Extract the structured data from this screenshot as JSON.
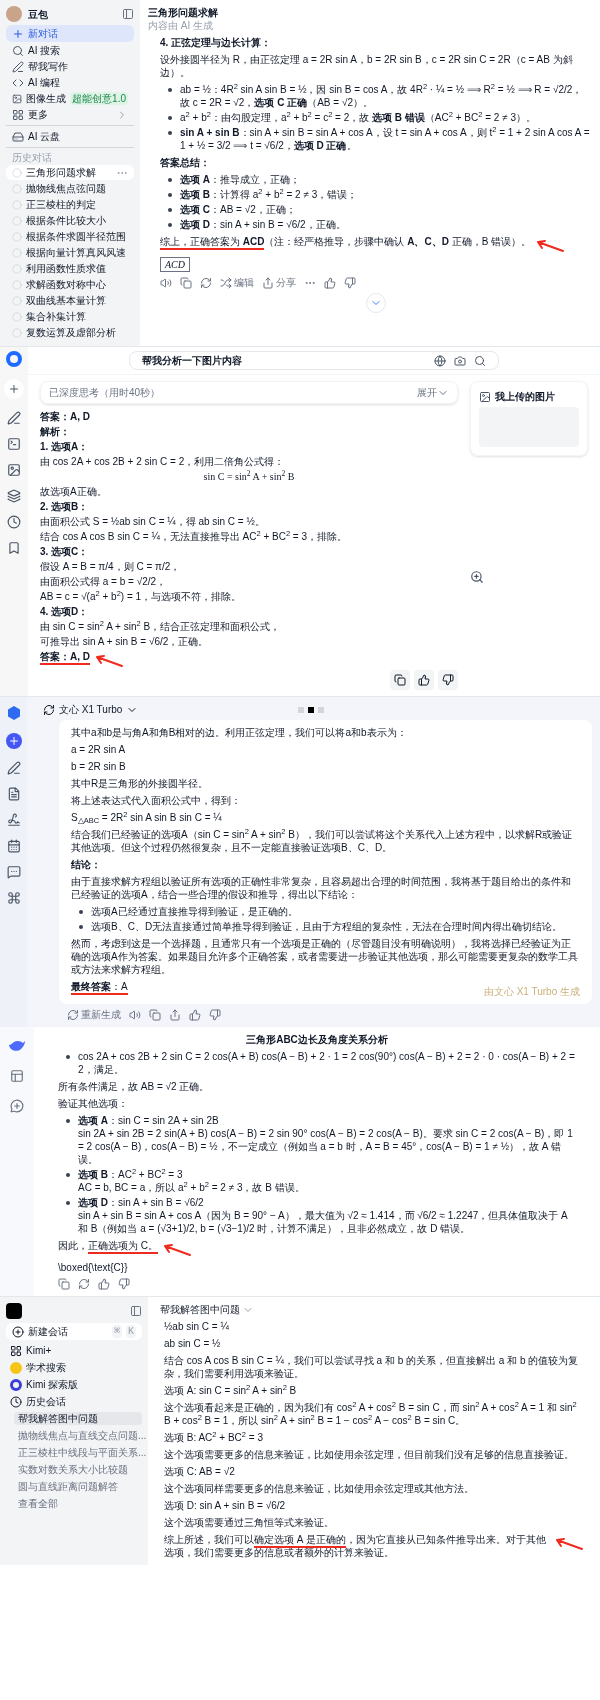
{
  "doubao": {
    "sidebar": {
      "brand": "豆包",
      "new_chat": "新对话",
      "nav": [
        {
          "label": "AI 搜索",
          "has_submenu": false
        },
        {
          "label": "帮我写作",
          "has_submenu": false
        },
        {
          "label": "AI 编程",
          "has_submenu": false
        },
        {
          "label": "图像生成",
          "badge": "超能创意1.0",
          "has_submenu": false
        },
        {
          "label": "更多",
          "has_submenu": true
        }
      ],
      "cloud": "AI 云盘",
      "history_heading": "历史对话",
      "history": [
        {
          "label": "三角形问题求解",
          "selected": true
        },
        {
          "label": "抛物线焦点弦问题",
          "selected": false
        },
        {
          "label": "正三棱柱的判定",
          "selected": false
        },
        {
          "label": "根据条件比较大小",
          "selected": false
        },
        {
          "label": "根据条件求圆半径范围",
          "selected": false
        },
        {
          "label": "根据向量计算真风风速",
          "selected": false
        },
        {
          "label": "利用函数性质求值",
          "selected": false
        },
        {
          "label": "求解函数对称中心",
          "selected": false
        },
        {
          "label": "双曲线基本量计算",
          "selected": false
        },
        {
          "label": "集合补集计算",
          "selected": false
        },
        {
          "label": "复数运算及虚部分析",
          "selected": false
        }
      ]
    },
    "header": {
      "title": "三角形问题求解",
      "subtitle": "内容由 AI 生成"
    },
    "blocks": [
      {
        "kind": "heading",
        "text": "4. 正弦定理与边长计算："
      },
      {
        "kind": "text",
        "text": "设外接圆半径为 R，由正弦定理 a = 2R sin A，b = 2R sin B，c = 2R sin C = 2R（c = AB 为斜边）。"
      },
      {
        "kind": "bullets",
        "items": [
          {
            "title": "ab = ½：4R$^{2}$ sin A sin B = ½，因 sin B = cos A，故 4R$^{2}$ · ¼ = ½ ⟹ R$^{2}$ = ½ ⟹ R = √2/2，故 c = 2R = √2，**选项 C 正确**（AB = √2）。"
          },
          {
            "title": "a$^{2}$ + b$^{2}$：由勾股定理，a$^{2}$ + b$^{2}$ = c$^{2}$ = 2，故 **选项 B 错误**（AC$^{2}$ + BC$^{2}$ = 2 ≠ 3）。"
          },
          {
            "title": "**sin A + sin B**：sin A + sin B = sin A + cos A，设 t = sin A + cos A，则 t$^{2}$ = 1 + 2 sin A cos A = 1 + ½ = 3/2 ⟹ t = √6/2，**选项 D 正确**。"
          }
        ]
      },
      {
        "kind": "heading",
        "text": "答案总结："
      },
      {
        "kind": "bullets",
        "items": [
          {
            "title": "**选项 A**：推导成立，正确；"
          },
          {
            "title": "**选项 B**：计算得 a$^{2}$ + b$^{2}$ = 2 ≠ 3，错误；"
          },
          {
            "title": "**选项 C**：AB = √2，正确；"
          },
          {
            "title": "**选项 D**：sin A + sin B = √6/2，正确。"
          }
        ]
      },
      {
        "kind": "segments",
        "arrow": true,
        "segments": [
          {
            "text": "综上，正确答案为 **ACD**",
            "underlined": true
          },
          {
            "text": "（注：经严格推导，步骤中确认 **A、C、D** 正确，B 错误）。",
            "underlined": false
          }
        ]
      },
      {
        "kind": "boxed",
        "text": "ACD"
      }
    ],
    "actions": [
      "编辑",
      "分享"
    ]
  },
  "yuanbao": {
    "search": {
      "value": "帮我分析一下图片内容"
    },
    "thinking": {
      "label": "已深度思考（用时40秒）",
      "toggle": "展开",
      "expanded": false
    },
    "blocks": [
      {
        "kind": "heading",
        "text": "答案：A, D"
      },
      {
        "kind": "heading",
        "text": "解析："
      },
      {
        "kind": "heading",
        "text": "1. 选项A："
      },
      {
        "kind": "text",
        "text": "由 cos 2A + cos 2B + 2 sin C = 2，利用二倍角公式得："
      },
      {
        "kind": "formula",
        "text": "sin C = sin$^{2}$ A + sin$^{2}$ B"
      },
      {
        "kind": "text",
        "text": "故选项A正确。"
      },
      {
        "kind": "heading",
        "text": "2. 选项B："
      },
      {
        "kind": "text",
        "text": "由面积公式 S = ½ab sin C = ¼，得 ab sin C = ½。"
      },
      {
        "kind": "text",
        "text": "结合 cos A cos B sin C = ¼，无法直接推导出 AC$^{2}$ + BC$^{2}$ = 3，排除。"
      },
      {
        "kind": "heading",
        "text": "3. 选项C："
      },
      {
        "kind": "text",
        "text": "假设 A = B = π/4，则 C = π/2，"
      },
      {
        "kind": "text",
        "text": "由面积公式得 a = b = √2/2，"
      },
      {
        "kind": "text",
        "text": "AB = c = √(a$^{2}$ + b$^{2}$) = 1，与选项不符，排除。"
      },
      {
        "kind": "heading",
        "text": "4. 选项D："
      },
      {
        "kind": "text",
        "text": "由 sin C = sin$^{2}$ A + sin$^{2}$ B，结合正弦定理和面积公式，"
      },
      {
        "kind": "text",
        "text": "可推导出 sin A + sin B = √6/2，正确。"
      },
      {
        "kind": "segments",
        "arrow": true,
        "segments": [
          {
            "text": "**答案：A, D**",
            "underlined": true
          }
        ]
      }
    ],
    "upload_card": {
      "title": "我上传的图片"
    }
  },
  "wenxin": {
    "model": "文心 X1 Turbo",
    "pages": [
      {
        "selected": false
      },
      {
        "selected": true
      },
      {
        "selected": false
      }
    ],
    "blocks": [
      {
        "kind": "text",
        "text": "其中a和b是与角A和角B相对的边。利用正弦定理，我们可以将a和b表示为："
      },
      {
        "kind": "text",
        "text": "a = 2R sin A"
      },
      {
        "kind": "text",
        "text": "b = 2R sin B"
      },
      {
        "kind": "text",
        "text": "其中R是三角形的外接圆半径。"
      },
      {
        "kind": "text",
        "text": "将上述表达式代入面积公式中，得到："
      },
      {
        "kind": "text",
        "text": "S$_{△ABC}$ = 2R$^{2}$ sin A sin B sin C = ¼"
      },
      {
        "kind": "text",
        "text": "结合我们已经验证的选项A（sin C = sin$^{2}$ A + sin$^{2}$ B），我们可以尝试将这个关系代入上述方程中，以求解R或验证其他选项。但这个过程仍然很复杂，且不一定能直接验证选项B、C、D。"
      },
      {
        "kind": "heading",
        "text": "结论："
      },
      {
        "kind": "text",
        "text": "由于直接求解方程组以验证所有选项的正确性非常复杂，且容易超出合理的时间范围，我将基于题目给出的条件和已经验证的选项A，结合一些合理的假设和推导，得出以下结论："
      },
      {
        "kind": "bullets",
        "items": [
          {
            "title": "选项A已经通过直接推导得到验证，是正确的。"
          },
          {
            "title": "选项B、C、D无法直接通过简单推导得到验证，且由于方程组的复杂性，无法在合理时间内得出确切结论。"
          }
        ]
      },
      {
        "kind": "text",
        "text": "然而，考虑到这是一个选择题，且通常只有一个选项是正确的（尽管题目没有明确说明），我将选择已经验证为正确的选项A作为答案。如果题目允许多个正确答案，或者需要进一步验证其他选项，那么可能需要更复杂的数学工具或方法来求解方程组。"
      },
      {
        "kind": "segments",
        "arrow": false,
        "segments": [
          {
            "text": "**最终答案**：A",
            "underlined": true
          }
        ]
      }
    ],
    "generated_label": "由文心 X1 Turbo 生成",
    "regenerate": "重新生成"
  },
  "deepseek": {
    "title": "三角形ABC边长及角度关系分析",
    "blocks": [
      {
        "kind": "bullets",
        "items": [
          {
            "title": "cos 2A + cos 2B + 2 sin C = 2 cos(A + B) cos(A − B) + 2 · 1 = 2 cos(90°) cos(A − B) + 2 = 2 · 0 · cos(A − B) + 2 = 2，满足。"
          }
        ]
      },
      {
        "kind": "text",
        "text": "所有条件满足，故 AB = √2 正确。"
      },
      {
        "kind": "text",
        "text": "验证其他选项："
      },
      {
        "kind": "bullets",
        "items": [
          {
            "title": "**选项 A**：sin C = sin 2A + sin 2B",
            "body": "sin 2A + sin 2B = 2 sin(A + B) cos(A − B) = 2 sin 90° cos(A − B) = 2 cos(A − B)。要求 sin C = 2 cos(A − B)，即 1 = 2 cos(A − B)，cos(A − B) = ½，不一定成立（例如当 a = b 时，A = B = 45°，cos(A − B) = 1 ≠ ½），故 A 错误。"
          },
          {
            "title": "**选项 B**：AC$^{2}$ + BC$^{2}$ = 3",
            "body": "AC = b, BC = a，所以 a$^{2}$ + b$^{2}$ = 2 ≠ 3，故 B 错误。"
          },
          {
            "title": "**选项 D**：sin A + sin B = √6/2",
            "body": "sin A + sin B = sin A + cos A（因为 B = 90° − A），最大值为 √2 ≈ 1.414，而 √6/2 ≈ 1.2247，但具体值取决于 A 和 B（例如当 a = (√3+1)/2, b = (√3−1)/2 时，计算不满足），且非必然成立，故 D 错误。"
          }
        ]
      },
      {
        "kind": "segments",
        "arrow": true,
        "segments": [
          {
            "text": "因此，",
            "underlined": false
          },
          {
            "text": "正确选项为 C。",
            "underlined": true
          }
        ]
      },
      {
        "kind": "text",
        "text": "\\boxed{\\text{C}}"
      }
    ]
  },
  "kimi": {
    "sidebar": {
      "new_chat": "新建会话",
      "shortcut": [
        "⌘",
        "K"
      ],
      "nav": [
        "Kimi+",
        "学术搜索",
        "Kimi 探索版"
      ],
      "history_heading": "历史会话",
      "history": [
        {
          "label": "帮我解答图中问题",
          "selected": true
        },
        {
          "label": "抛物线焦点与直线交点问题...",
          "selected": false
        },
        {
          "label": "正三棱柱中线段与平面关系...",
          "selected": false
        },
        {
          "label": "实数对数关系大小比较题",
          "selected": false
        },
        {
          "label": "圆与直线距离问题解答",
          "selected": false
        }
      ],
      "view_all": "查看全部"
    },
    "title": "帮我解答图中问题",
    "blocks": [
      {
        "kind": "text",
        "text": "½ab sin C = ¼"
      },
      {
        "kind": "text",
        "text": "ab sin C = ½"
      },
      {
        "kind": "text",
        "text": "结合 cos A cos B sin C = ¼，我们可以尝试寻找 a 和 b 的关系，但直接解出 a 和 b 的值较为复杂，我们需要利用选项来验证。"
      },
      {
        "kind": "text",
        "text": "选项 A: sin C = sin$^{2}$ A + sin$^{2}$ B"
      },
      {
        "kind": "text",
        "text": "这个选项看起来是正确的，因为我们有 cos$^{2}$ A + cos$^{2}$ B = sin C，而 sin$^{2}$ A + cos$^{2}$ A = 1 和 sin$^{2}$ B + cos$^{2}$ B = 1，所以 sin$^{2}$ A + sin$^{2}$ B = 1 − cos$^{2}$ A − cos$^{2}$ B = sin C。"
      },
      {
        "kind": "text",
        "text": "选项 B: AC$^{2}$ + BC$^{2}$ = 3"
      },
      {
        "kind": "text",
        "text": "这个选项需要更多的信息来验证，比如使用余弦定理，但目前我们没有足够的信息直接验证。"
      },
      {
        "kind": "text",
        "text": "选项 C: AB = √2"
      },
      {
        "kind": "text",
        "text": "这个选项同样需要更多的信息来验证，比如使用余弦定理或其他方法。"
      },
      {
        "kind": "text",
        "text": "选项 D: sin A + sin B = √6/2"
      },
      {
        "kind": "text",
        "text": "这个选项需要通过三角恒等式来验证。"
      },
      {
        "kind": "segments",
        "arrow": true,
        "segments": [
          {
            "text": "综上所述，我们可以",
            "underlined": false
          },
          {
            "text": "确定选项 A 是正确的",
            "underlined": true
          },
          {
            "text": "，因为它直接从已知条件推导出来。对于其他选项，我们需要更多的信息或者额外的计算来验证。",
            "underlined": false
          }
        ]
      }
    ]
  }
}
